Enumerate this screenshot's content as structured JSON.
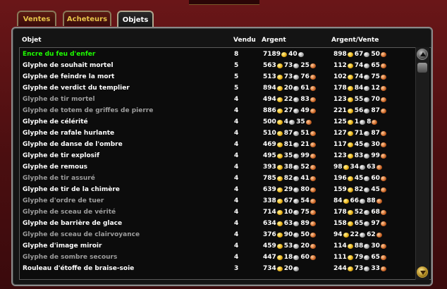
{
  "tabs": [
    {
      "label": "Ventes",
      "active": false
    },
    {
      "label": "Acheteurs",
      "active": false
    },
    {
      "label": "Objets",
      "active": true
    }
  ],
  "columns": {
    "item": "Objet",
    "sold": "Vendu",
    "money": "Argent",
    "per_sale": "Argent/Vente"
  },
  "colors": {
    "uncommon": "#1eff00",
    "common": "#ffffff",
    "poor": "#9d9d9d"
  },
  "rows": [
    {
      "name": "Encre du feu d'enfer",
      "quality": "uncommon",
      "sold": "8",
      "money": {
        "g": "7189",
        "s": "40",
        "c": ""
      },
      "per_sale": {
        "g": "898",
        "s": "67",
        "c": "50"
      }
    },
    {
      "name": "Glyphe de souhait mortel",
      "quality": "common",
      "sold": "5",
      "money": {
        "g": "563",
        "s": "73",
        "c": "25"
      },
      "per_sale": {
        "g": "112",
        "s": "74",
        "c": "65"
      }
    },
    {
      "name": "Glyphe de feindre la mort",
      "quality": "common",
      "sold": "5",
      "money": {
        "g": "513",
        "s": "73",
        "c": "76"
      },
      "per_sale": {
        "g": "102",
        "s": "74",
        "c": "75"
      }
    },
    {
      "name": "Glyphe de verdict du templier",
      "quality": "common",
      "sold": "5",
      "money": {
        "g": "894",
        "s": "20",
        "c": "61"
      },
      "per_sale": {
        "g": "178",
        "s": "84",
        "c": "12"
      }
    },
    {
      "name": "Glyphe de tir mortel",
      "quality": "poor",
      "sold": "4",
      "money": {
        "g": "494",
        "s": "22",
        "c": "83"
      },
      "per_sale": {
        "g": "123",
        "s": "55",
        "c": "70"
      }
    },
    {
      "name": "Glyphe de totem de griffes de pierre",
      "quality": "poor",
      "sold": "4",
      "money": {
        "g": "886",
        "s": "27",
        "c": "49"
      },
      "per_sale": {
        "g": "221",
        "s": "56",
        "c": "87"
      }
    },
    {
      "name": "Glyphe de célérité",
      "quality": "common",
      "sold": "4",
      "money": {
        "g": "500",
        "s": "4",
        "c": "35"
      },
      "per_sale": {
        "g": "125",
        "s": "1",
        "c": "8"
      }
    },
    {
      "name": "Glyphe de rafale hurlante",
      "quality": "common",
      "sold": "4",
      "money": {
        "g": "510",
        "s": "87",
        "c": "51"
      },
      "per_sale": {
        "g": "127",
        "s": "71",
        "c": "87"
      }
    },
    {
      "name": "Glyphe de danse de l'ombre",
      "quality": "common",
      "sold": "4",
      "money": {
        "g": "469",
        "s": "81",
        "c": "21"
      },
      "per_sale": {
        "g": "117",
        "s": "45",
        "c": "30"
      }
    },
    {
      "name": "Glyphe de tir explosif",
      "quality": "common",
      "sold": "4",
      "money": {
        "g": "495",
        "s": "35",
        "c": "99"
      },
      "per_sale": {
        "g": "123",
        "s": "83",
        "c": "99"
      }
    },
    {
      "name": "Glyphe de remous",
      "quality": "common",
      "sold": "4",
      "money": {
        "g": "393",
        "s": "38",
        "c": "52"
      },
      "per_sale": {
        "g": "98",
        "s": "34",
        "c": "63"
      }
    },
    {
      "name": "Glyphe de tir assuré",
      "quality": "poor",
      "sold": "4",
      "money": {
        "g": "785",
        "s": "82",
        "c": "41"
      },
      "per_sale": {
        "g": "196",
        "s": "45",
        "c": "60"
      }
    },
    {
      "name": "Glyphe de tir de la chimère",
      "quality": "common",
      "sold": "4",
      "money": {
        "g": "639",
        "s": "29",
        "c": "80"
      },
      "per_sale": {
        "g": "159",
        "s": "82",
        "c": "45"
      }
    },
    {
      "name": "Glyphe d'ordre de tuer",
      "quality": "poor",
      "sold": "4",
      "money": {
        "g": "338",
        "s": "67",
        "c": "54"
      },
      "per_sale": {
        "g": "84",
        "s": "66",
        "c": "88"
      }
    },
    {
      "name": "Glyphe de sceau de vérité",
      "quality": "poor",
      "sold": "4",
      "money": {
        "g": "714",
        "s": "10",
        "c": "75"
      },
      "per_sale": {
        "g": "178",
        "s": "52",
        "c": "68"
      }
    },
    {
      "name": "Glyphe de barrière de glace",
      "quality": "common",
      "sold": "4",
      "money": {
        "g": "634",
        "s": "63",
        "c": "89"
      },
      "per_sale": {
        "g": "158",
        "s": "65",
        "c": "97"
      }
    },
    {
      "name": "Glyphe de sceau de clairvoyance",
      "quality": "poor",
      "sold": "4",
      "money": {
        "g": "376",
        "s": "90",
        "c": "50"
      },
      "per_sale": {
        "g": "94",
        "s": "22",
        "c": "62"
      }
    },
    {
      "name": "Glyphe d'image miroir",
      "quality": "common",
      "sold": "4",
      "money": {
        "g": "459",
        "s": "53",
        "c": "20"
      },
      "per_sale": {
        "g": "114",
        "s": "88",
        "c": "30"
      }
    },
    {
      "name": "Glyphe de sombre secours",
      "quality": "poor",
      "sold": "4",
      "money": {
        "g": "447",
        "s": "18",
        "c": "60"
      },
      "per_sale": {
        "g": "111",
        "s": "79",
        "c": "65"
      }
    },
    {
      "name": "Rouleau d'étoffe de braise-soie",
      "quality": "common",
      "sold": "3",
      "money": {
        "g": "734",
        "s": "20",
        "c": ""
      },
      "per_sale": {
        "g": "244",
        "s": "73",
        "c": "33"
      }
    }
  ],
  "scrollbar": {
    "up_icon": "arrow-up-icon",
    "down_icon": "arrow-down-icon"
  }
}
